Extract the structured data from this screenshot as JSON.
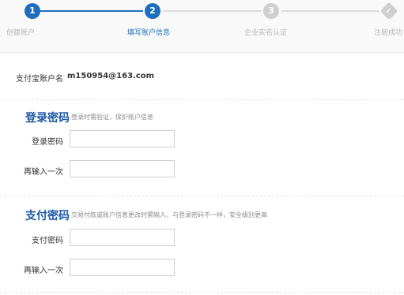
{
  "steps": [
    {
      "num": "1",
      "label": "创建账户",
      "state": "done"
    },
    {
      "num": "2",
      "label": "填写账户信息",
      "state": "active"
    },
    {
      "num": "3",
      "label": "企业实名认证",
      "state": "pending"
    },
    {
      "num": "✓",
      "label": "注册成功",
      "state": "pending"
    }
  ],
  "account": {
    "label": "支付宝账户名",
    "value": "m150954@163.com"
  },
  "login_section": {
    "title": "登录密码",
    "hint": "登录时需验证，保护账户信息",
    "field1_label": "登录密码",
    "field2_label": "再输入一次"
  },
  "pay_section": {
    "title": "支付密码",
    "hint": "交易付款或账户信息更改时需输入，与登录密码不一样，安全级别更高",
    "field1_label": "支付密码",
    "field2_label": "再输入一次"
  },
  "colors": {
    "accent": "#1d6fbd",
    "title": "#1d5aa6",
    "inactive": "#cfcfcf"
  }
}
